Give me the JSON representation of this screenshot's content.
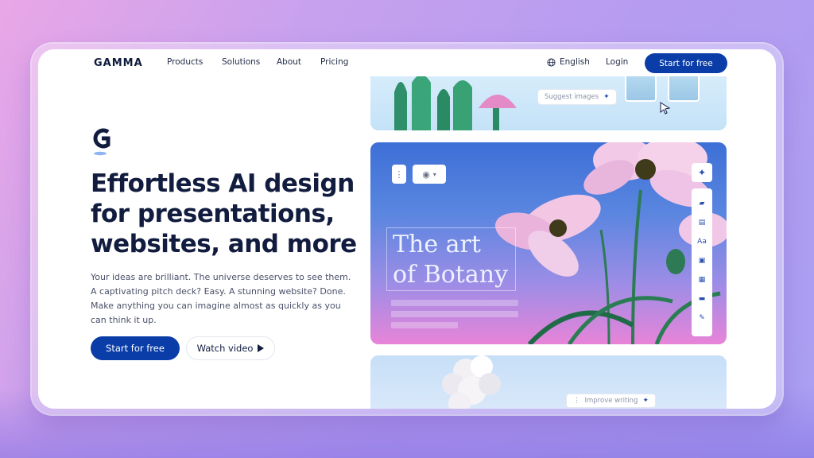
{
  "nav": {
    "logo": "GAMMA",
    "links": [
      "Products",
      "Solutions",
      "About",
      "Pricing"
    ],
    "language": "English",
    "login": "Login",
    "cta": "Start for free"
  },
  "hero": {
    "headline_lines": [
      "Effortless AI design",
      "for presentations,",
      "websites, and more"
    ],
    "subcopy": "Your ideas are brilliant. The universe deserves to see them. A captivating pitch deck? Easy. A stunning website? Done. Make anything you can imagine almost as quickly as you can think it up.",
    "cta_primary": "Start for free",
    "cta_secondary": "Watch video"
  },
  "preview": {
    "suggest_chip": "Suggest images",
    "art_title_lines": [
      "The art",
      "of Botany"
    ],
    "toolbar_text_icon": "Aa",
    "improve_chip": "Improve writing"
  },
  "colors": {
    "brand": "#0a3da8",
    "heading": "#111c3f"
  }
}
